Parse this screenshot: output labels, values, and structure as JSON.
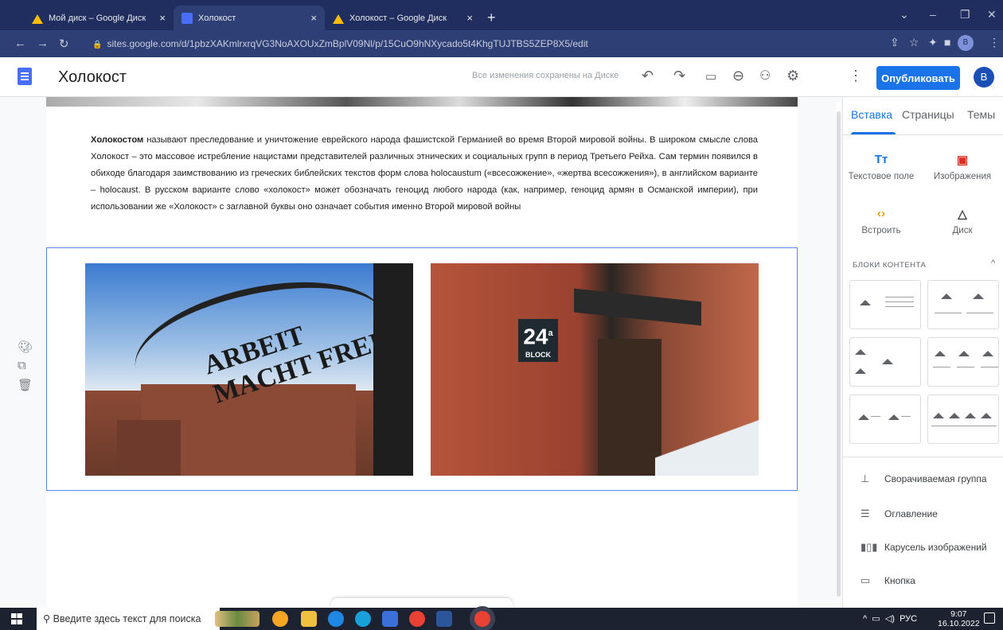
{
  "browser": {
    "tabs": [
      {
        "title": "Мой диск – Google Диск",
        "close": "×"
      },
      {
        "title": "Холокост",
        "close": "×"
      },
      {
        "title": "Холокост – Google Диск",
        "close": "×"
      }
    ],
    "new_tab": "+",
    "url": "sites.google.com/d/1pbzXAKmlrxrqVG3NoAXOUxZmBplV09Nl/p/15CuO9hNXycado5t4KhgTUJTBS5ZEP8X5/edit",
    "profile_initial": "В"
  },
  "sites": {
    "title": "Холокост",
    "save_status": "Все изменения сохранены на Диске",
    "publish_label": "Опубликовать",
    "avatar_initial": "В"
  },
  "content": {
    "lead_bold": "Холокостом",
    "body": " называют преследование и уничтожение еврейского народа фашистской Германией во время Второй мировой войны. В широком смысле слова Холокост – это массовое истребление нацистами представителей различных этнических и социальных групп в период Третьего Рейха. Сам термин появился в обиходе благодаря заимствованию из греческих библейских текстов форм слова holocaustum («всесожжение», «жертва всесожжения»), в английском варианте – holocaust. В русском варианте слово «холокост» может обозначать геноцид любого народа (как, например, геноцид армян в Османской империи), при использовании же «Холокост» с заглавной буквы оно означает события именно Второй мировой войны",
    "photo1_text": "ARBEIT MACHT FREI",
    "photo2_num": "24",
    "photo2_sup": "a",
    "photo2_label": "BLOCK"
  },
  "panel": {
    "tabs": [
      "Вставка",
      "Страницы",
      "Темы"
    ],
    "insert": {
      "text_box": "Текстовое поле",
      "images": "Изображения",
      "embed": "Встроить",
      "drive": "Диск"
    },
    "blocks_header": "БЛОКИ КОНТЕНТА",
    "items": [
      "Сворачиваемая группа",
      "Оглавление",
      "Карусель изображений",
      "Кнопка"
    ]
  },
  "taskbar": {
    "search_placeholder": "Введите здесь текст для поиска",
    "lang": "РУС",
    "time": "9:07",
    "date": "16.10.2022"
  }
}
